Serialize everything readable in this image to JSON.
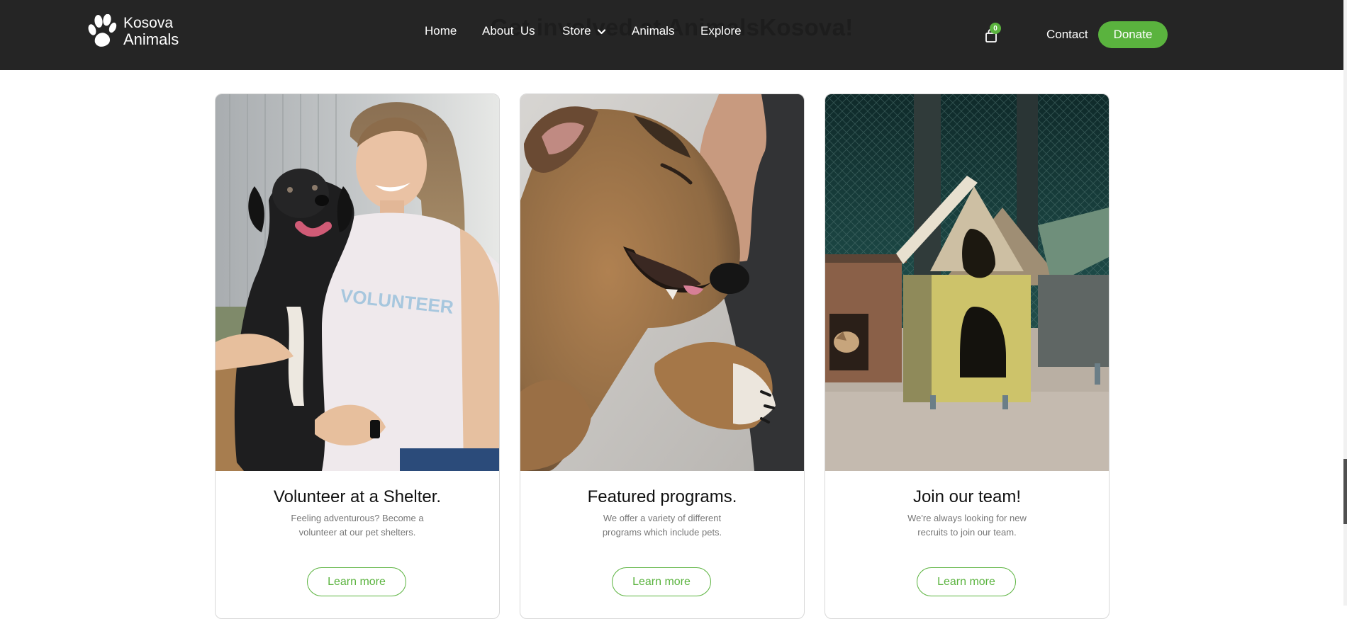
{
  "header": {
    "background_heading": "Get involved at AnimalsKosova!",
    "logo": {
      "line1": "Kosova",
      "line2": "Animals",
      "icon": "paw-icon"
    },
    "nav": [
      {
        "label": "Home"
      },
      {
        "label": "About  Us"
      },
      {
        "label": "Store",
        "icon": "chevron-down-icon"
      },
      {
        "label": "Animals"
      },
      {
        "label": "Explore"
      }
    ],
    "cart": {
      "icon": "shopping-bag-icon",
      "count": "0"
    },
    "contact_label": "Contact",
    "donate_label": "Donate"
  },
  "cards": [
    {
      "title": "Volunteer at a Shelter.",
      "description": "Feeling adventurous? Become a volunteer at our pet shelters.",
      "button_label": "Learn more",
      "image": "woman-with-black-dog-photo",
      "shirt_text": "VOLUNTEER"
    },
    {
      "title": "Featured programs.",
      "description": "We offer a variety of different programs which include pets.",
      "button_label": "Learn more",
      "image": "brown-dog-photo"
    },
    {
      "title": "Join our team!",
      "description": "We're always looking for new recruits to join our team.",
      "button_label": "Learn more",
      "image": "dog-kennels-photo"
    }
  ],
  "colors": {
    "header_bg": "#252525",
    "accent_green": "#5ab33e",
    "text_dark": "#111111",
    "text_muted": "#777777"
  }
}
